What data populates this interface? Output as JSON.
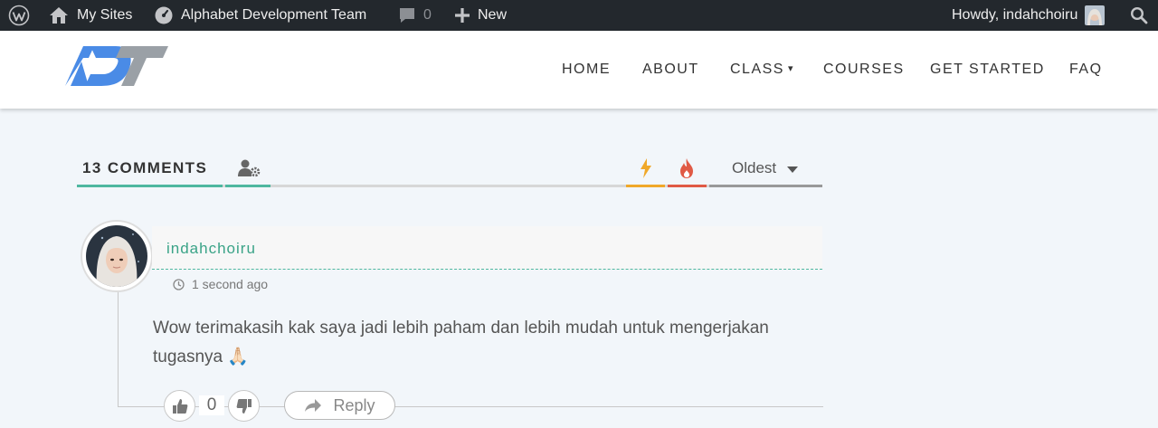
{
  "adminbar": {
    "my_sites": "My Sites",
    "site_name": "Alphabet Development Team",
    "comments_count": "0",
    "new_label": "New",
    "howdy": "Howdy, indahchoiru",
    "icons": [
      "wordpress-icon",
      "home-icon",
      "dashboard-icon",
      "comment-icon",
      "plus-icon",
      "search-icon"
    ]
  },
  "logo": {
    "text": "ADT"
  },
  "nav": {
    "home": "HOME",
    "about": "ABOUT",
    "class": "CLASS",
    "class_caret": "▾",
    "courses": "COURSES",
    "get_started": "GET STARTED",
    "faq": "FAQ"
  },
  "comments": {
    "count_label": "13 COMMENTS",
    "sort_selected": "Oldest",
    "colors": {
      "accent": "#4fb7a0",
      "lightning": "#f0a829",
      "fire": "#e05a45"
    },
    "items": [
      {
        "author": "indahchoiru",
        "time": "1 second ago",
        "text": "Wow terimakasih kak saya jadi lebih paham dan lebih mudah untuk mengerjakan tugasnya 🙏🏻",
        "votes": "0",
        "reply_label": "Reply"
      }
    ]
  }
}
